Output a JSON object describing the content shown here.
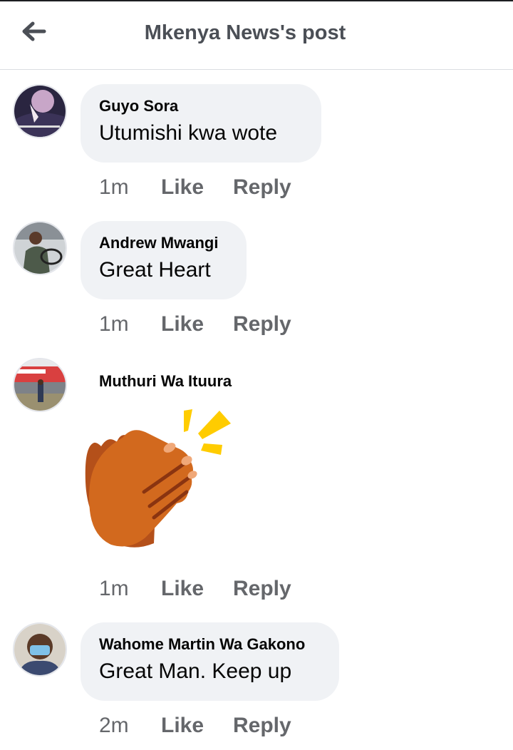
{
  "header": {
    "title": "Mkenya News's post",
    "back_icon": "arrow-left-icon"
  },
  "comments": [
    {
      "author": "Guyo Sora",
      "text": "Utumishi kwa wote",
      "time": "1m",
      "like_label": "Like",
      "reply_label": "Reply"
    },
    {
      "author": "Andrew Mwangi",
      "text": "Great Heart",
      "time": "1m",
      "like_label": "Like",
      "reply_label": "Reply"
    },
    {
      "author": "Muthuri Wa Ituura",
      "sticker": "clapping-hands-icon",
      "time": "1m",
      "like_label": "Like",
      "reply_label": "Reply"
    },
    {
      "author": "Wahome Martin Wa Gakono",
      "text": "Great Man. Keep up",
      "time": "2m",
      "like_label": "Like",
      "reply_label": "Reply"
    }
  ],
  "colors": {
    "bubble": "#f0f2f5",
    "meta_text": "#65676b",
    "title_text": "#4b4f56",
    "clap_dark": "#b4501a",
    "clap_light": "#d2691e",
    "sparkle": "#ffcc00"
  }
}
